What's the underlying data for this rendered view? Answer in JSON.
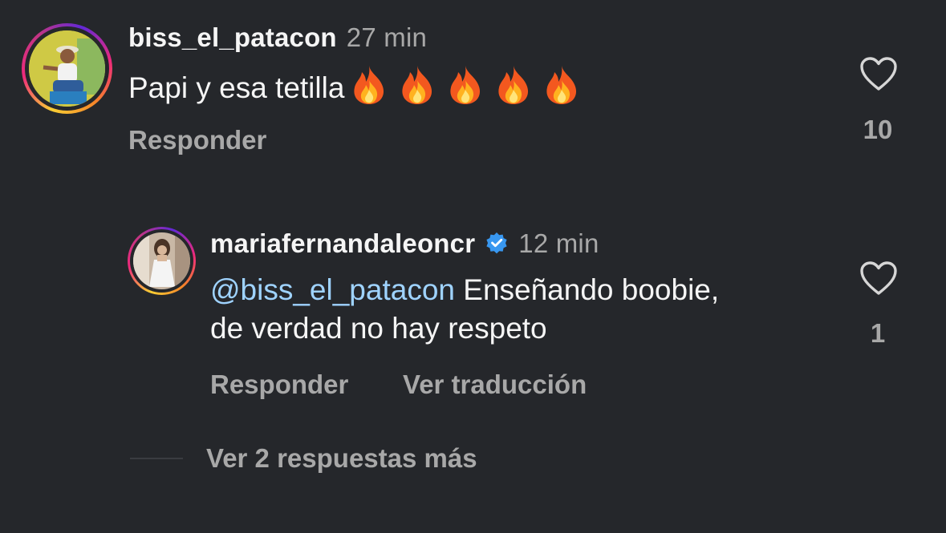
{
  "comments": [
    {
      "username": "biss_el_patacon",
      "time": "27 min",
      "text": "Papi y esa tetilla",
      "emojis": [
        "🔥",
        "🔥",
        "🔥",
        "🔥",
        "🔥"
      ],
      "reply_label": "Responder",
      "like_count": "10"
    },
    {
      "username": "mariafernandaleoncr",
      "verified": true,
      "time": "12 min",
      "mention": "@biss_el_patacon",
      "text_line1": " Enseñando boobie,",
      "text_line2": "de verdad no hay respeto",
      "reply_label": "Responder",
      "translate_label": "Ver traducción",
      "like_count": "1"
    }
  ],
  "more_replies_label": "Ver 2 respuestas más",
  "colors": {
    "background": "#25272b",
    "mention": "#9fd3ff",
    "muted": "#a8a8a8",
    "verified": "#3897f0"
  }
}
